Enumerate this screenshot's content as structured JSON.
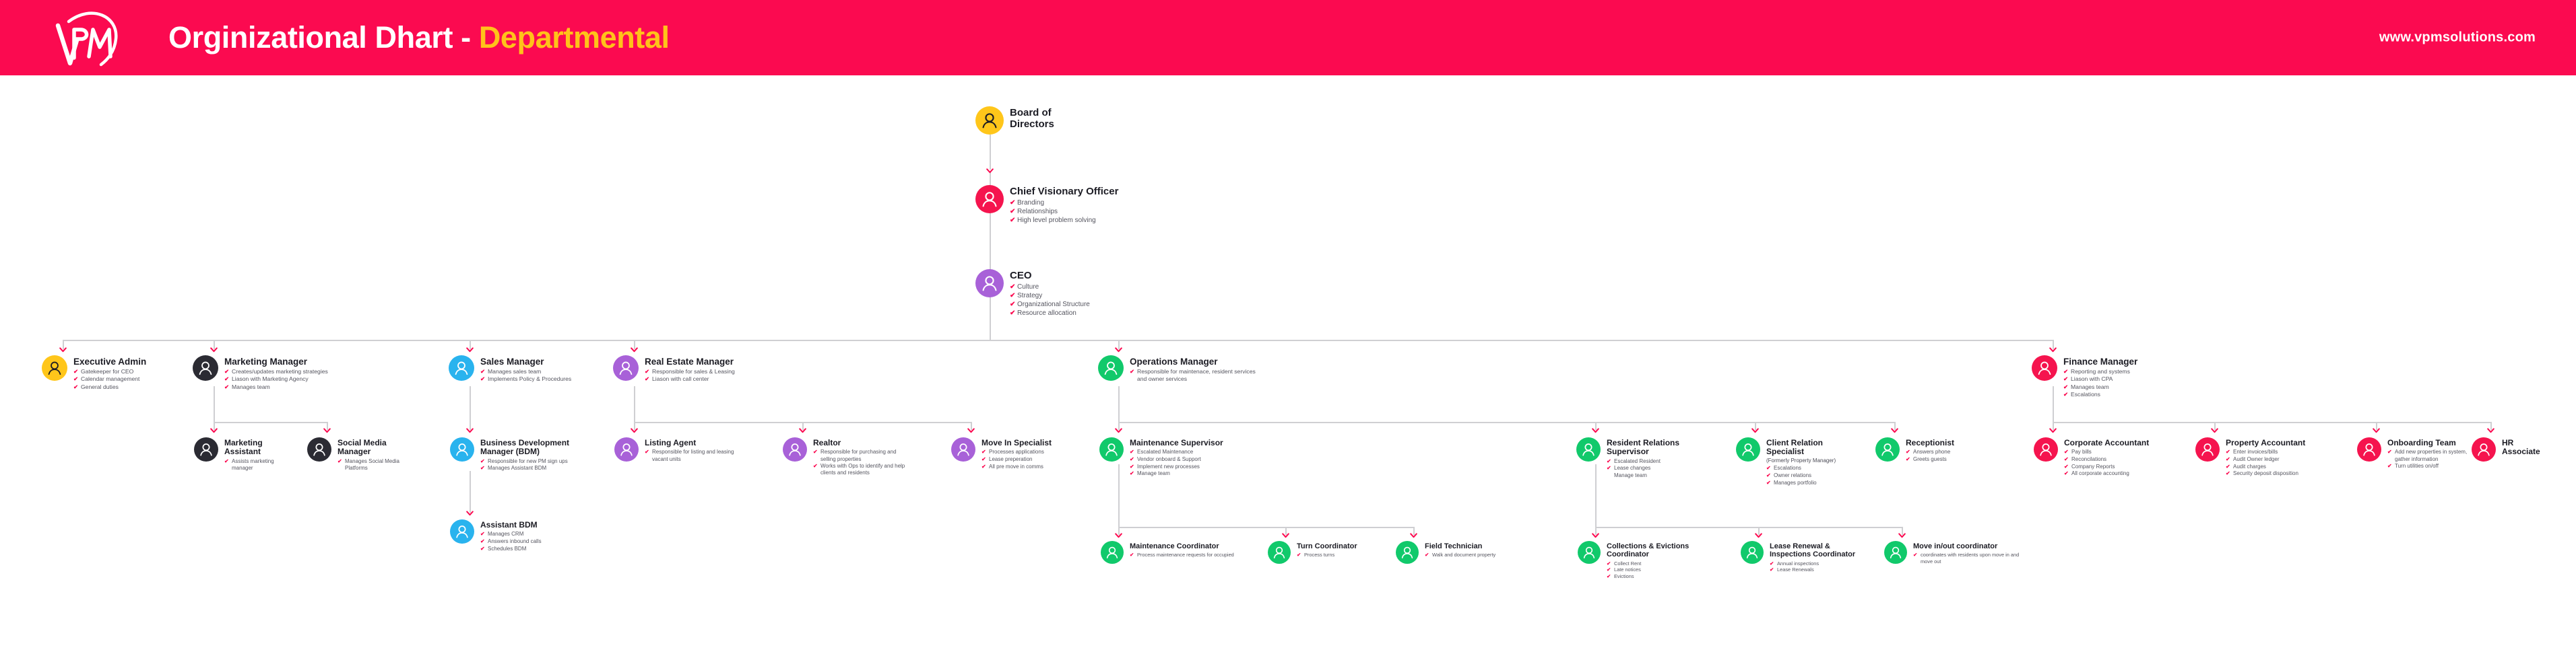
{
  "header": {
    "title_main": "Orginizational Dhart - ",
    "title_accent": "Departmental",
    "url": "www.vpmsolutions.com",
    "logo_text": "vPM",
    "brand_color": "#FB0A50",
    "accent_color": "#FFC21A"
  },
  "colors": {
    "yellow": "#FFC61A",
    "pink": "#F5144E",
    "purple": "#A861D8",
    "dark": "#2B2B33",
    "blue": "#29B3EE",
    "green": "#11C96B",
    "tick": "#FB0A50",
    "line": "#cfcfd2"
  },
  "nodes": [
    {
      "id": "board-of-directors",
      "title": "Board of\nDirectors",
      "color": "yellow",
      "icon": "person-icon-dark",
      "bullets": []
    },
    {
      "id": "chief-visionary-officer",
      "title": "Chief Visionary Officer",
      "color": "pink",
      "icon": "person-icon",
      "bullets": [
        "Branding",
        "Relationships",
        "High level problem solving"
      ]
    },
    {
      "id": "ceo",
      "title": "CEO",
      "color": "purple",
      "icon": "person-icon",
      "bullets": [
        "Culture",
        "Strategy",
        "Organizational Structure",
        "Resource allocation"
      ]
    },
    {
      "id": "executive-admin",
      "title": "Executive Admin",
      "color": "yellow",
      "icon": "person-icon-dark",
      "bullets": [
        "Gatekeeper for CEO",
        "Calendar management",
        "General duties"
      ]
    },
    {
      "id": "marketing-manager",
      "title": "Marketing Manager",
      "color": "dark",
      "icon": "person-icon",
      "bullets": [
        "Creates/updates marketing strategies",
        "Liason with Marketing Agency",
        "Manages team"
      ]
    },
    {
      "id": "marketing-assistant",
      "title": "Marketing\nAssistant",
      "color": "dark",
      "icon": "person-icon",
      "bullets": [
        "Assists marketing manager"
      ]
    },
    {
      "id": "social-media-manager",
      "title": "Social Media\nManager",
      "color": "dark",
      "icon": "person-icon",
      "bullets": [
        "Manages Social Media Platforms"
      ]
    },
    {
      "id": "sales-manager",
      "title": "Sales Manager",
      "color": "blue",
      "icon": "person-icon",
      "bullets": [
        "Manages sales team",
        "Implements Policy & Procedures"
      ]
    },
    {
      "id": "business-development-manager",
      "title": "Business Development\nManager (BDM)",
      "color": "blue",
      "icon": "person-icon",
      "bullets": [
        "Responsible for new PM sign ups",
        "Manages Assistant BDM"
      ]
    },
    {
      "id": "assistant-bdm",
      "title": "Assistant BDM",
      "color": "blue",
      "icon": "person-icon",
      "bullets": [
        "Manages CRM",
        "Answers inbound calls",
        "Schedules BDM"
      ]
    },
    {
      "id": "real-estate-manager",
      "title": "Real Estate Manager",
      "color": "purple",
      "icon": "person-icon",
      "bullets": [
        "Responsible for sales & Leasing",
        "Liason with call center"
      ]
    },
    {
      "id": "listing-agent",
      "title": "Listing Agent",
      "color": "purple",
      "icon": "person-icon",
      "bullets": [
        "Responsible for listing and leasing vacant units"
      ]
    },
    {
      "id": "realtor",
      "title": "Realtor",
      "color": "purple",
      "icon": "person-icon",
      "bullets": [
        "Responsible for purchasing and selling properties",
        "Works with Ops to identify and help clients and residents"
      ]
    },
    {
      "id": "move-in-specialist",
      "title": "Move In Specialist",
      "color": "purple",
      "icon": "person-icon",
      "bullets": [
        "Processes applications",
        "Lease preperation",
        "All pre move in comms"
      ]
    },
    {
      "id": "operations-manager",
      "title": "Operations Manager",
      "color": "green",
      "icon": "person-icon",
      "bullets": [
        "Responsible for maintenace, resident services and owner services"
      ]
    },
    {
      "id": "maintenance-supervisor",
      "title": "Maintenance Supervisor",
      "color": "green",
      "icon": "person-icon",
      "bullets": [
        "Escalated Maintenance",
        "Vendor onboard & Support",
        "Implement new processes",
        "Manage team"
      ]
    },
    {
      "id": "maintenance-coordinator",
      "title": "Maintenance Coordinator",
      "color": "green",
      "icon": "person-icon",
      "bullets": [
        "Process maintenance requests for occupied"
      ]
    },
    {
      "id": "turn-coordinator",
      "title": "Turn Coordinator",
      "color": "green",
      "icon": "person-icon",
      "bullets": [
        "Process turns"
      ]
    },
    {
      "id": "field-technician",
      "title": "Field Technician",
      "color": "green",
      "icon": "person-icon",
      "bullets": [
        "Walk and document property"
      ]
    },
    {
      "id": "resident-relations-supervisor",
      "title": "Resident Relations\nSupervisor",
      "color": "green",
      "icon": "person-icon",
      "bullets": [
        "Escalated Resident",
        "Lease changes"
      ],
      "plain_lines": [
        "Manage team"
      ]
    },
    {
      "id": "collections-evictions-coordinator",
      "title": "Collections & Evictions\nCoordinator",
      "color": "green",
      "icon": "person-icon",
      "bullets": [
        "Collect Rent",
        "Late notices",
        "Evictions"
      ]
    },
    {
      "id": "lease-renewal-inspections-coordinator",
      "title": "Lease Renewal &\nInspections Coordinator",
      "color": "green",
      "icon": "person-icon",
      "bullets": [
        "Annual inspections",
        "Lease Renewals"
      ]
    },
    {
      "id": "move-in-out-coordinator",
      "title": "Move in/out coordinator",
      "color": "green",
      "icon": "person-icon",
      "bullets": [
        "coordinates with residents upon move in and move out"
      ]
    },
    {
      "id": "client-relation-specialist",
      "title": "Client Relation\nSpecialist",
      "subtitle": "(Formerly Property Manager)",
      "color": "green",
      "icon": "person-icon",
      "bullets": [
        "Escalations",
        "Owner relations",
        "Manages portfolio"
      ]
    },
    {
      "id": "receptionist",
      "title": "Receptionist",
      "color": "green",
      "icon": "person-icon",
      "bullets": [
        "Answers phone",
        "Greets guests"
      ]
    },
    {
      "id": "finance-manager",
      "title": "Finance Manager",
      "color": "pink",
      "icon": "person-icon",
      "bullets": [
        "Reporting and systems",
        "Liason with CPA",
        "Manages team",
        "Escalations"
      ]
    },
    {
      "id": "corporate-accountant",
      "title": "Corporate Accountant",
      "color": "pink",
      "icon": "person-icon",
      "bullets": [
        "Pay bills",
        "Reconcilations",
        "Company Reports",
        "All corporate accounting"
      ]
    },
    {
      "id": "property-accountant",
      "title": "Property Accountant",
      "color": "pink",
      "icon": "person-icon",
      "bullets": [
        "Enter invoices/bills",
        "Audit Owner ledger",
        "Audit charges",
        "Security deposit disposition"
      ]
    },
    {
      "id": "onboarding-team",
      "title": "Onboarding Team",
      "color": "pink",
      "icon": "person-icon",
      "bullets": [
        "Add new properties in system, gather information",
        "Turn utilities on/off"
      ]
    },
    {
      "id": "hr-associate",
      "title": "HR\nAssociate",
      "color": "pink",
      "icon": "person-icon",
      "bullets": []
    }
  ]
}
